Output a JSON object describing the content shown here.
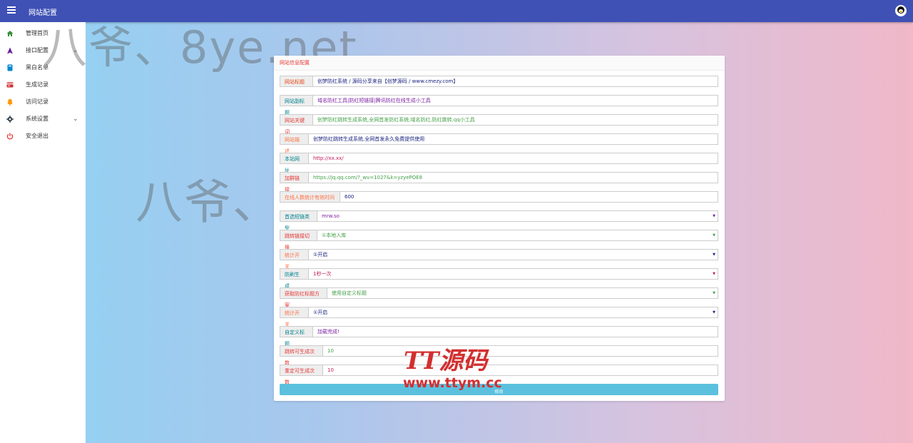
{
  "header": {
    "title": "网站配置",
    "menu_icon": "menu-icon",
    "avatar_icon": "qq-penguin-icon",
    "bg_color": "#3f51b5"
  },
  "sidebar": {
    "items": [
      {
        "label": "管理首页",
        "icon": "home-icon",
        "color": "#388e3c"
      },
      {
        "label": "接口配置",
        "icon": "navigation-arrow-icon",
        "color": "#6a1b9a",
        "expandable": true
      },
      {
        "label": "黑白名单",
        "icon": "book-icon",
        "color": "#0288d1"
      },
      {
        "label": "生成记录",
        "icon": "card-icon",
        "color": "#d32f2f"
      },
      {
        "label": "访问记录",
        "icon": "bell-icon",
        "color": "#ff9800"
      },
      {
        "label": "系统设置",
        "icon": "gear-icon",
        "color": "#37474f",
        "expandable": true
      },
      {
        "label": "安全退出",
        "icon": "power-icon",
        "color": "#e53935"
      }
    ]
  },
  "watermark": {
    "text": "八爷、8ye.net"
  },
  "card": {
    "title": "网站信息配置",
    "fields": [
      {
        "label": "网站标题",
        "value": "创梦防红系统 / 源码分享来自【创梦源码 / www.cmezy.com】",
        "label_color": "#e64a19",
        "value_color": "#1a237e",
        "type": "text"
      },
      {
        "label": "网站副标题",
        "value": "域名防红工具|防红短链接|腾讯防红在线生成小工具",
        "label_color": "#00838f",
        "value_color": "#7b1fa2",
        "type": "text"
      },
      {
        "label": "网站关键词",
        "value": "创梦防红跳转生成系统,全网首发防红系统,域名防红,防红跳转,qq小工具",
        "label_color": "#e53935",
        "value_color": "#43a047",
        "type": "text"
      },
      {
        "label": "网站描述",
        "value": "创梦防红跳转生成系统,全网首发永久免费提供使用",
        "label_color": "#ff7043",
        "value_color": "#1a237e",
        "type": "text"
      },
      {
        "label": "本站网址",
        "value": "http://xx.xx/",
        "label_color": "#00838f",
        "value_color": "#c2185b",
        "type": "text"
      },
      {
        "label": "加群链接",
        "value": "https://jq.qq.com/?_wv=1027&k=yzyePOE8",
        "label_color": "#e53935",
        "value_color": "#43a047",
        "type": "text"
      },
      {
        "label": "在线人数统计有效时间",
        "value": "600",
        "label_color": "#ff7043",
        "value_color": "#1a237e",
        "type": "text"
      },
      {
        "label": "首选短链类型",
        "value": "mrw.so",
        "label_color": "#00838f",
        "value_color": "#7b1fa2",
        "type": "select"
      },
      {
        "label": "跳转链接切换",
        "value": "①本地入库",
        "label_color": "#e53935",
        "value_color": "#43a047",
        "type": "select"
      },
      {
        "label": "统计开关",
        "value": "①开启",
        "label_color": "#ff7043",
        "value_color": "#1a237e",
        "type": "select"
      },
      {
        "label": "防刷生成",
        "value": "1秒一次",
        "label_color": "#00838f",
        "value_color": "#c2185b",
        "type": "select"
      },
      {
        "label": "获取防红标题方案",
        "value": "使用自定义标题",
        "label_color": "#e53935",
        "value_color": "#43a047",
        "type": "select"
      },
      {
        "label": "统计开关",
        "value": "①开启",
        "label_color": "#ff7043",
        "value_color": "#1a237e",
        "type": "select"
      },
      {
        "label": "自定义标题",
        "value": "加载完成!",
        "label_color": "#00838f",
        "value_color": "#7b1fa2",
        "type": "text"
      },
      {
        "label": "跳转可生成次数",
        "value": "10",
        "label_color": "#e53935",
        "value_color": "#43a047",
        "type": "text"
      },
      {
        "label": "重定可生成次数",
        "value": "10",
        "label_color": "#e53935",
        "value_color": "#c2185b",
        "type": "text"
      }
    ],
    "submit_label": "修改"
  },
  "brand": {
    "logo": "TT源码",
    "url": "www.ttym.cc",
    "color": "#d32f2f"
  }
}
